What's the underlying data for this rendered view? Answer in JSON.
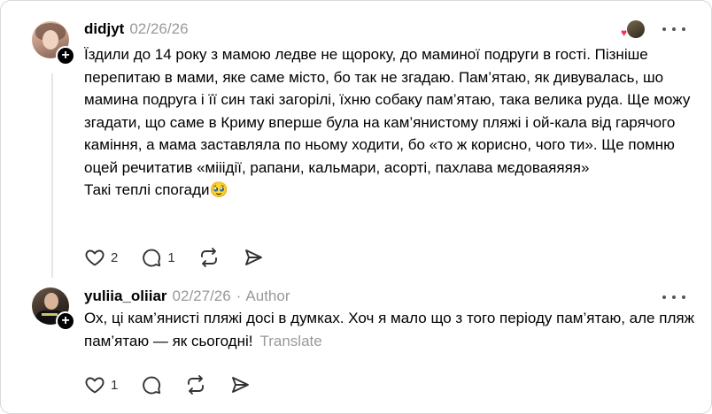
{
  "posts": [
    {
      "username": "didjyt",
      "date": "02/26/26",
      "lines": [
        "Їздили до 14 року з мамою ледве не щороку, до маминої подруги в гості. Пізніше перепитаю в мами, яке саме місто, бо так не згадаю. Пам’ятаю, як дивувалась, шо мамина подруга і її син такі загорілі, їхню собаку пам’ятаю, така велика руда. Ще можу згадати, що саме в Криму вперше була на кам’янистому пляжі і ой-кала від гарячого каміння, а мама заставляла по ньому ходити, бо «то ж корисно, чого ти». Ще помню оцей речитатив «мііідії, рапани, кальмари, асорті, пахлава мєдоваяяяя»",
        "Такі теплі спогади🥹"
      ],
      "like_count": "2",
      "reply_count": "1"
    },
    {
      "username": "yuliia_oliiar",
      "date": "02/27/26",
      "author_label": "Author",
      "text": "Ох, ці кам’янисті пляжі досі в думках. Хоч я мало що з того періоду пам’ятаю, але пляж пам’ятаю — як сьогодні!",
      "translate_label": "Translate",
      "like_count": "1"
    }
  ],
  "colors": {
    "muted": "#999999",
    "like_heart": "#ff2d55",
    "thread_line": "#e5e5e5"
  },
  "icons": [
    "plus-icon",
    "heart-icon",
    "comment-icon",
    "repost-icon",
    "share-icon",
    "more-icon"
  ]
}
